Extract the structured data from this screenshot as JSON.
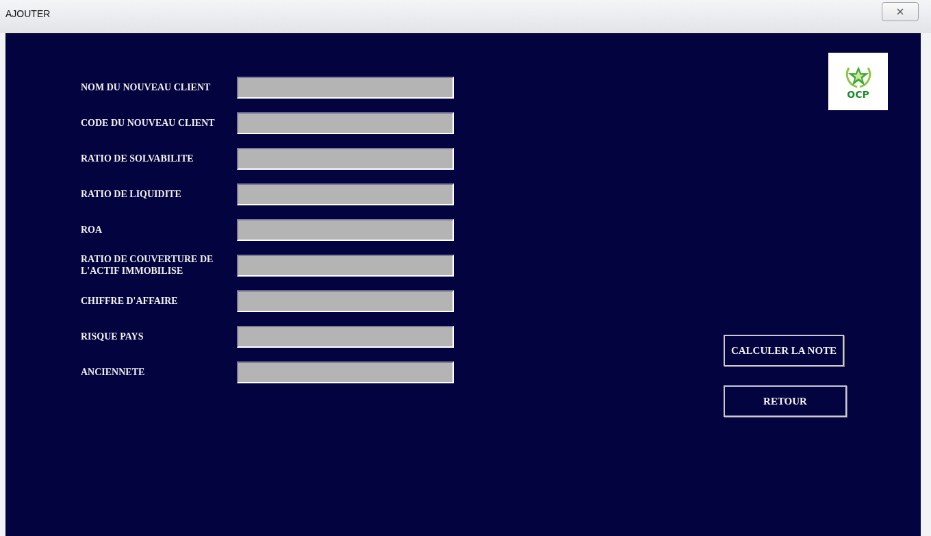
{
  "window": {
    "title": "AJOUTER"
  },
  "form": {
    "fields": [
      {
        "label": "NOM DU NOUVEAU  CLIENT"
      },
      {
        "label": "CODE DU NOUVEAU CLIENT"
      },
      {
        "label": "RATIO DE SOLVABILITE"
      },
      {
        "label": "RATIO DE LIQUIDITE"
      },
      {
        "label": "ROA"
      },
      {
        "label": "RATIO DE COUVERTURE DE L'ACTIF IMMOBILISE"
      },
      {
        "label": "CHIFFRE D'AFFAIRE"
      },
      {
        "label": "RISQUE PAYS"
      },
      {
        "label": "ANCIENNETE"
      }
    ]
  },
  "logo": {
    "text": "OCP"
  },
  "buttons": [
    "CALCULER LA NOTE",
    "RETOUR"
  ]
}
